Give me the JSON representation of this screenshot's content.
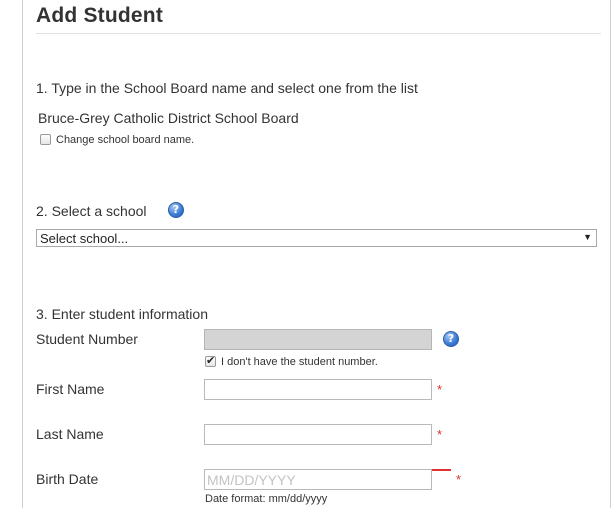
{
  "page": {
    "title": "Add Student"
  },
  "step1": {
    "label": "1. Type in the School Board name and select one from the list",
    "selected_board": "Bruce-Grey Catholic District School Board",
    "change_checkbox": {
      "label": "Change school board name.",
      "checked": false
    }
  },
  "step2": {
    "label": "2. Select a school",
    "help_icon": "question-circle-icon",
    "school_select": {
      "value": "Select school...",
      "arrow": "▼"
    }
  },
  "step3": {
    "label": "3. Enter student information",
    "student_number": {
      "label": "Student Number",
      "value": "",
      "disabled": true,
      "help_icon": "question-circle-icon",
      "no_number_checkbox": {
        "label": "I don't have the student number.",
        "checked": true
      }
    },
    "first_name": {
      "label": "First Name",
      "value": "",
      "required_mark": "*"
    },
    "last_name": {
      "label": "Last Name",
      "value": "",
      "required_mark": "*"
    },
    "birth_date": {
      "label": "Birth Date",
      "placeholder": "MM/DD/YYYY",
      "required_mark": "*",
      "hint": "Date format: mm/dd/yyyy"
    }
  },
  "colors": {
    "required": "#e03030",
    "help_icon": "#3f7fd6",
    "disabled_field": "#d4d4d4"
  },
  "help_glyph": "?"
}
